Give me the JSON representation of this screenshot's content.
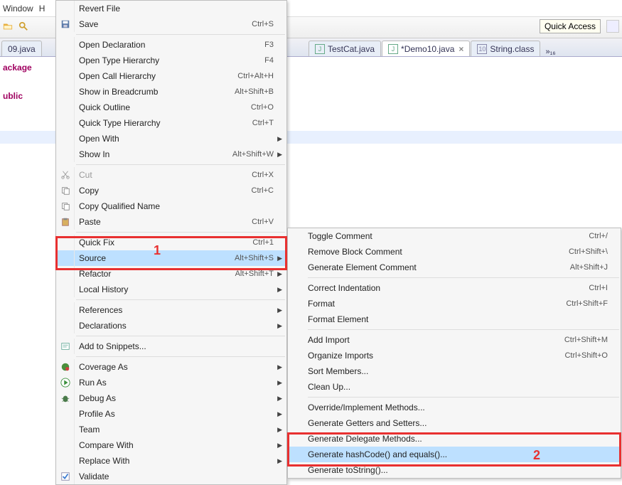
{
  "menubar": {
    "window": "Window",
    "help": "H"
  },
  "quickAccess": "Quick Access",
  "tabs": {
    "left": "09.java",
    "t1": "TestCat.java",
    "t2": "*Demo10.java",
    "t3": "String.class",
    "more": "»₁₆"
  },
  "code": {
    "l1a": "ackage",
    "l1b": "",
    "l2a": "ublic",
    "l2b": ""
  },
  "menu": [
    {
      "label": "Revert File",
      "shortcut": "",
      "icon": "",
      "sepBefore": true
    },
    {
      "label": "Save",
      "shortcut": "Ctrl+S",
      "icon": "save"
    },
    {
      "label": "Open Declaration",
      "shortcut": "F3",
      "sepBefore": true
    },
    {
      "label": "Open Type Hierarchy",
      "shortcut": "F4"
    },
    {
      "label": "Open Call Hierarchy",
      "shortcut": "Ctrl+Alt+H"
    },
    {
      "label": "Show in Breadcrumb",
      "shortcut": "Alt+Shift+B"
    },
    {
      "label": "Quick Outline",
      "shortcut": "Ctrl+O"
    },
    {
      "label": "Quick Type Hierarchy",
      "shortcut": "Ctrl+T"
    },
    {
      "label": "Open With",
      "arrow": true
    },
    {
      "label": "Show In",
      "shortcut": "Alt+Shift+W",
      "arrow": true
    },
    {
      "label": "Cut",
      "shortcut": "Ctrl+X",
      "icon": "cut",
      "disabled": true,
      "sepBefore": true
    },
    {
      "label": "Copy",
      "shortcut": "Ctrl+C",
      "icon": "copy"
    },
    {
      "label": "Copy Qualified Name",
      "icon": "copy"
    },
    {
      "label": "Paste",
      "shortcut": "Ctrl+V",
      "icon": "paste"
    },
    {
      "label": "Quick Fix",
      "shortcut": "Ctrl+1",
      "sepBefore": true
    },
    {
      "label": "Source",
      "shortcut": "Alt+Shift+S",
      "arrow": true,
      "hover": true
    },
    {
      "label": "Refactor",
      "shortcut": "Alt+Shift+T",
      "arrow": true
    },
    {
      "label": "Local History",
      "arrow": true
    },
    {
      "label": "References",
      "arrow": true,
      "sepBefore": true
    },
    {
      "label": "Declarations",
      "arrow": true
    },
    {
      "label": "Add to Snippets...",
      "icon": "snippet",
      "sepBefore": true
    },
    {
      "label": "Coverage As",
      "icon": "coverage",
      "arrow": true,
      "sepBefore": true
    },
    {
      "label": "Run As",
      "icon": "run",
      "arrow": true
    },
    {
      "label": "Debug As",
      "icon": "debug",
      "arrow": true
    },
    {
      "label": "Profile As",
      "arrow": true
    },
    {
      "label": "Team",
      "arrow": true
    },
    {
      "label": "Compare With",
      "arrow": true
    },
    {
      "label": "Replace With",
      "arrow": true
    },
    {
      "label": "Validate",
      "icon": "check"
    }
  ],
  "submenu": [
    {
      "label": "Toggle Comment",
      "shortcut": "Ctrl+/"
    },
    {
      "label": "Remove Block Comment",
      "shortcut": "Ctrl+Shift+\\"
    },
    {
      "label": "Generate Element Comment",
      "shortcut": "Alt+Shift+J"
    },
    {
      "label": "Correct Indentation",
      "shortcut": "Ctrl+I",
      "sepBefore": true
    },
    {
      "label": "Format",
      "shortcut": "Ctrl+Shift+F"
    },
    {
      "label": "Format Element"
    },
    {
      "label": "Add Import",
      "shortcut": "Ctrl+Shift+M",
      "sepBefore": true
    },
    {
      "label": "Organize Imports",
      "shortcut": "Ctrl+Shift+O"
    },
    {
      "label": "Sort Members..."
    },
    {
      "label": "Clean Up..."
    },
    {
      "label": "Override/Implement Methods...",
      "sepBefore": true
    },
    {
      "label": "Generate Getters and Setters..."
    },
    {
      "label": "Generate Delegate Methods..."
    },
    {
      "label": "Generate hashCode() and equals()...",
      "hover": true
    },
    {
      "label": "Generate toString()..."
    }
  ],
  "annotations": {
    "n1": "1",
    "n2": "2"
  },
  "watermark": ""
}
